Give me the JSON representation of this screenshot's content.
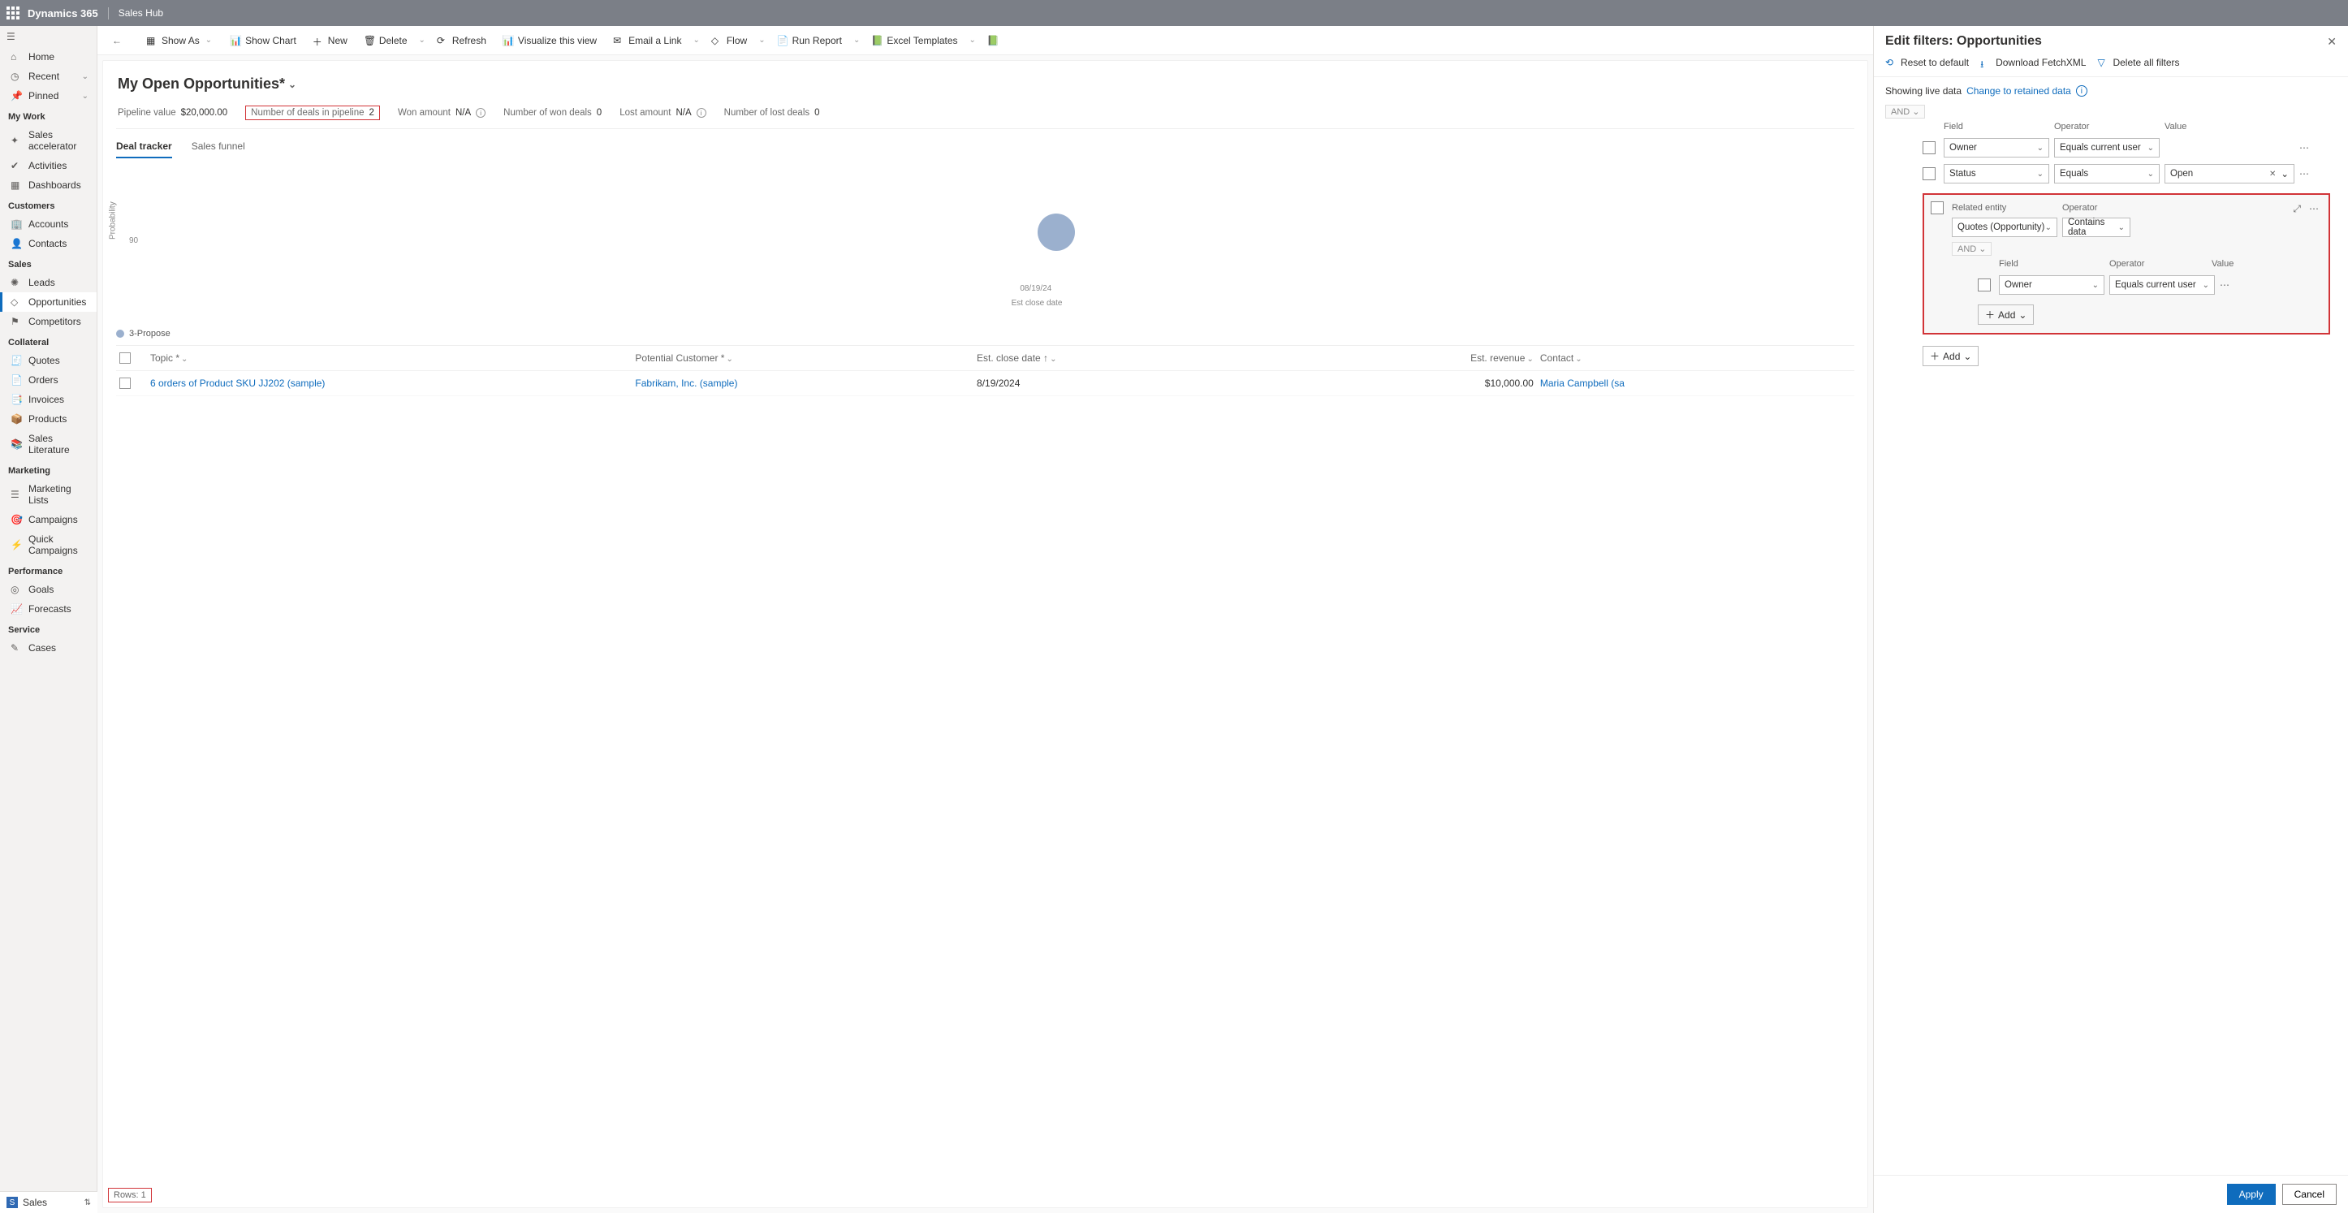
{
  "topbar": {
    "brand": "Dynamics 365",
    "app": "Sales Hub"
  },
  "sidebar": {
    "home": "Home",
    "recent": "Recent",
    "pinned": "Pinned",
    "sections": [
      {
        "title": "My Work",
        "items": [
          "Sales accelerator",
          "Activities",
          "Dashboards"
        ]
      },
      {
        "title": "Customers",
        "items": [
          "Accounts",
          "Contacts"
        ]
      },
      {
        "title": "Sales",
        "items": [
          "Leads",
          "Opportunities",
          "Competitors"
        ],
        "selected": 1
      },
      {
        "title": "Collateral",
        "items": [
          "Quotes",
          "Orders",
          "Invoices",
          "Products",
          "Sales Literature"
        ]
      },
      {
        "title": "Marketing",
        "items": [
          "Marketing Lists",
          "Campaigns",
          "Quick Campaigns"
        ]
      },
      {
        "title": "Performance",
        "items": [
          "Goals",
          "Forecasts"
        ]
      },
      {
        "title": "Service",
        "items": [
          "Cases"
        ]
      }
    ],
    "area": "Sales"
  },
  "cmdbar": {
    "show_as": "Show As",
    "show_chart": "Show Chart",
    "new": "New",
    "delete": "Delete",
    "refresh": "Refresh",
    "visualize": "Visualize this view",
    "email": "Email a Link",
    "flow": "Flow",
    "run_report": "Run Report",
    "excel": "Excel Templates"
  },
  "view": {
    "title": "My Open Opportunities*",
    "stats": [
      {
        "label": "Pipeline value",
        "value": "$20,000.00"
      },
      {
        "label": "Number of deals in pipeline",
        "value": "2",
        "hi": true
      },
      {
        "label": "Won amount",
        "value": "N/A",
        "info": true
      },
      {
        "label": "Number of won deals",
        "value": "0"
      },
      {
        "label": "Lost amount",
        "value": "N/A",
        "info": true
      },
      {
        "label": "Number of lost deals",
        "value": "0"
      }
    ],
    "tabs": [
      "Deal tracker",
      "Sales funnel"
    ],
    "chart": {
      "y_axis": "Probability",
      "y_tick": "90",
      "x_date": "08/19/24",
      "x_label": "Est close date"
    },
    "legend": "3-Propose",
    "columns": [
      "Topic *",
      "Potential Customer *",
      "Est. close date ↑",
      "Est. revenue",
      "Contact"
    ],
    "rows": [
      {
        "topic": "6 orders of Product SKU JJ202 (sample)",
        "customer": "Fabrikam, Inc. (sample)",
        "date": "8/19/2024",
        "rev": "$10,000.00",
        "contact": "Maria Campbell (sa"
      }
    ],
    "rows_footer": "Rows: 1"
  },
  "panel": {
    "title": "Edit filters: Opportunities",
    "tools": [
      "Reset to default",
      "Download FetchXML",
      "Delete all filters"
    ],
    "note": "Showing live data",
    "note_link": "Change to retained data",
    "group": "AND",
    "heads": {
      "field": "Field",
      "operator": "Operator",
      "value": "Value",
      "related": "Related entity"
    },
    "conds": [
      {
        "field": "Owner",
        "op": "Equals current user",
        "val": ""
      },
      {
        "field": "Status",
        "op": "Equals",
        "val": "Open",
        "pill": true
      }
    ],
    "related": {
      "entity": "Quotes (Opportunity)",
      "op": "Contains data",
      "group": "AND",
      "conds": [
        {
          "field": "Owner",
          "op": "Equals current user"
        }
      ],
      "add": "Add"
    },
    "add_outer": "Add",
    "apply": "Apply",
    "cancel": "Cancel"
  }
}
